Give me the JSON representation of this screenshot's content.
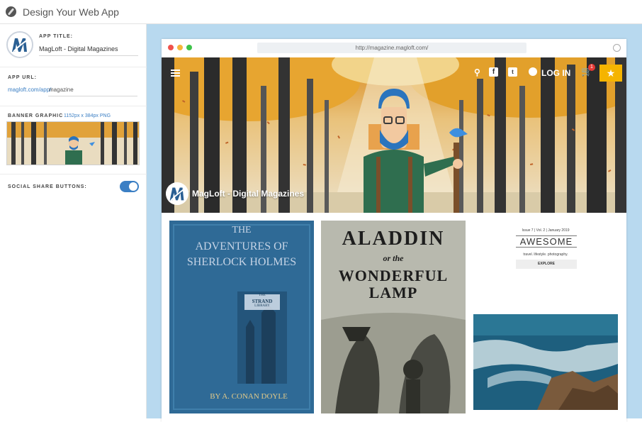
{
  "topbar": {
    "title": "Design Your Web App",
    "icon": "compass-icon"
  },
  "sidebar": {
    "app_title_label": "APP TITLE:",
    "app_title_value": "MagLoft - Digital Magazines",
    "app_url_label": "APP URL:",
    "app_url_prefix": "magloft.com/app/",
    "app_url_value": "magazine",
    "banner_label": "BANNER GRAPHIC",
    "banner_hint": "1152px x 384px PNG",
    "social_label": "SOCIAL SHARE BUTTONS:",
    "social_enabled": true
  },
  "preview": {
    "url": "http://magazine.magloft.com/",
    "login_label": "LOG IN",
    "cart_count": "1",
    "brand_name": "MagLoft - Digital Magazines"
  },
  "cards": {
    "sherlock": {
      "line1": "THE",
      "line2": "ADVENTURES OF",
      "line3": "SHERLOCK HOLMES",
      "badge_top": "THE",
      "badge_mid": "STRAND",
      "badge_bot": "LIBRARY",
      "author": "BY  A. CONAN DOYLE"
    },
    "aladdin": {
      "line1": "ALADDIN",
      "line2": "or the",
      "line3": "WONDERFUL LAMP"
    },
    "awesome": {
      "meta": "Issue 7  |  Vol. 2  |  January 2019",
      "title": "AWESOME",
      "tagline": "travel. lifestyle. photography.",
      "button": "EXPLORE"
    }
  },
  "colors": {
    "accent": "#3b7fc4",
    "star": "#f5b400",
    "canvas": "#b8d9ef"
  }
}
